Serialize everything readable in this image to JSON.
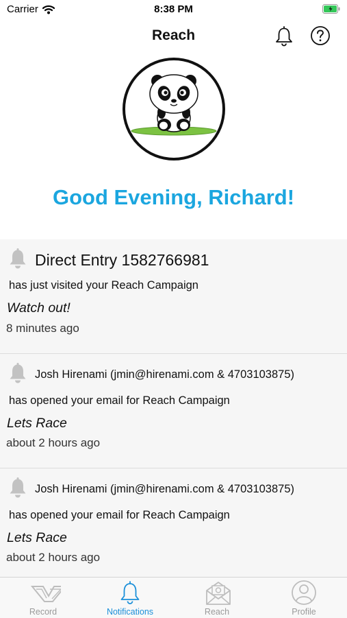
{
  "status_bar": {
    "carrier": "Carrier",
    "time": "8:38 PM"
  },
  "nav": {
    "title": "Reach",
    "bell_icon": "bell-icon",
    "help_icon": "question-circle-icon"
  },
  "greeting": "Good Evening, Richard!",
  "notifications": [
    {
      "name": "Direct Entry 1582766981",
      "action": "has just visited your Reach Campaign",
      "note": "Watch out!",
      "time_ago": "8 minutes ago"
    },
    {
      "name": "Josh Hirenami (jmin@hirenami.com & 4703103875)",
      "action": "has opened your email for Reach Campaign",
      "note": "Lets Race",
      "time_ago": "about 2 hours ago"
    },
    {
      "name": "Josh Hirenami (jmin@hirenami.com & 4703103875)",
      "action": "has opened your email for Reach Campaign",
      "note": "Lets Race",
      "time_ago": "about 2 hours ago"
    }
  ],
  "tabs": [
    {
      "label": "Record",
      "icon": "record-logo-icon",
      "active": false
    },
    {
      "label": "Notifications",
      "icon": "bell-icon",
      "active": true
    },
    {
      "label": "Reach",
      "icon": "mail-icon",
      "active": false
    },
    {
      "label": "Profile",
      "icon": "person-icon",
      "active": false
    }
  ],
  "colors": {
    "accent": "#1ba6df",
    "tab_active": "#1a8fd9",
    "tab_inactive": "#9a9a9a",
    "battery": "#34c759"
  }
}
